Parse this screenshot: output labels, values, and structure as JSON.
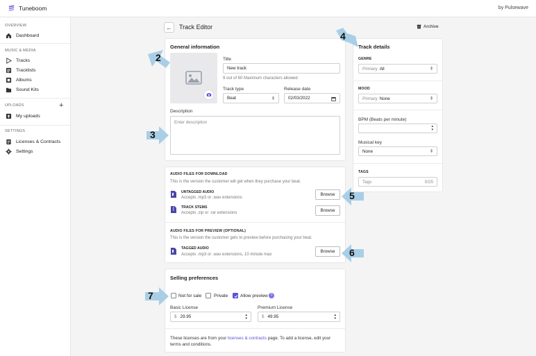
{
  "app": {
    "name": "Tuneboom",
    "byline": "by Pulsewave"
  },
  "sidebar": {
    "sections": [
      {
        "label": "OVERVIEW",
        "items": [
          {
            "label": "Dashboard",
            "icon": "home-icon"
          }
        ]
      },
      {
        "label": "MUSIC & MEDIA",
        "items": [
          {
            "label": "Tracks",
            "icon": "play-icon"
          },
          {
            "label": "Tracklists",
            "icon": "list-icon"
          },
          {
            "label": "Albums",
            "icon": "album-icon"
          },
          {
            "label": "Sound Kits",
            "icon": "folder-icon"
          }
        ]
      },
      {
        "label": "UPLOADS",
        "items": [
          {
            "label": "My uploads",
            "icon": "upload-icon"
          }
        ]
      },
      {
        "label": "SETTINGS",
        "items": [
          {
            "label": "Licenses & Contracts",
            "icon": "contract-icon"
          },
          {
            "label": "Settings",
            "icon": "gear-icon"
          }
        ]
      }
    ]
  },
  "header": {
    "title": "Track Editor",
    "archive_label": "Archive"
  },
  "general": {
    "heading": "General information",
    "title_label": "Title",
    "title_value": "New track",
    "title_hint": "9 out of 60 Maximum characters allowed",
    "track_type_label": "Track type",
    "track_type_value": "Beat",
    "release_date_label": "Release date",
    "release_date_value": "02/03/2022",
    "description_label": "Description",
    "description_placeholder": "Enter description"
  },
  "audio": {
    "download_heading": "AUDIO FILES FOR DOWNLOAD",
    "download_sub": "This is the version the customer will get when they purchase your beat.",
    "files": [
      {
        "name": "UNTAGGED AUDIO",
        "desc": "Accepts .mp3 or .wav extensions",
        "button": "Browse"
      },
      {
        "name": "TRACK STEMS",
        "desc": "Accepts .zip or .rar extensions",
        "button": "Browse"
      }
    ],
    "preview_heading": "AUDIO FILES FOR PREVIEW (OPTIONAL)",
    "preview_sub": "This is the version the customer gets to preview before purchasing your beat.",
    "preview_file": {
      "name": "TAGGED AUDIO",
      "desc": "Accepts .mp3 or .wav extensions, 10 minute max",
      "button": "Browse"
    }
  },
  "selling": {
    "heading": "Selling preferences",
    "options": [
      {
        "label": "Not for sale",
        "checked": false
      },
      {
        "label": "Private",
        "checked": false
      },
      {
        "label": "Allow preview",
        "checked": true
      }
    ],
    "basic_label": "Basic License",
    "basic_currency": "$",
    "basic_value": "29.95",
    "premium_label": "Premium License",
    "premium_currency": "$",
    "premium_value": "49.95",
    "footer_before": "These licenses are from your ",
    "footer_link": "licenses & contracts",
    "footer_after": " page. To add a license, edit your",
    "footer_line2": "terms and conditions."
  },
  "details": {
    "heading": "Track details",
    "genre_label": "GENRE",
    "genre_prefix": "Primary",
    "genre_value": "All",
    "mood_label": "MOOD",
    "mood_prefix": "Primary",
    "mood_value": "None",
    "bpm_label": "BPM (Beats per minute)",
    "key_label": "Musical key",
    "key_value": "None",
    "tags_label": "TAGS",
    "tags_placeholder": "Tags",
    "tags_count": "0/25"
  },
  "callouts": [
    "2",
    "3",
    "4",
    "5",
    "6",
    "7"
  ],
  "colors": {
    "accent": "#5b53d6",
    "callout": "#a9cfe6"
  }
}
